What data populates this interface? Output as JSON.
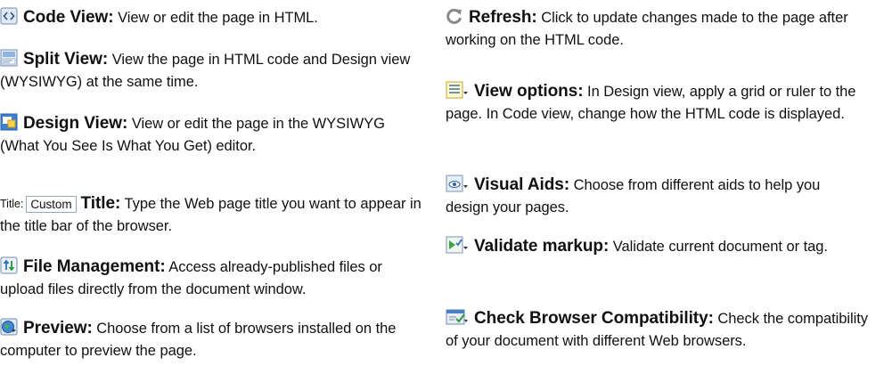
{
  "left": [
    {
      "icon": "code-view-icon",
      "term": "Code View:",
      "desc": " View or edit the page in HTML."
    },
    {
      "icon": "split-view-icon",
      "term": "Split View:",
      "desc": " View the page in HTML code and Design view (WYSIWYG) at the same time."
    },
    {
      "icon": "design-view-icon",
      "term": "Design View:",
      "desc": " View or edit the page in the WYSIWYG (What You See Is What You Get) editor."
    },
    {
      "title_widget_label": "Title:",
      "title_widget_value": "Custom",
      "term": "Title:",
      "desc": " Type the Web page title you want to appear in the title bar of the browser."
    },
    {
      "icon": "file-management-icon",
      "term": "File Management:",
      "desc": " Access already-published files or upload files directly from the document window."
    },
    {
      "icon": "preview-globe-icon",
      "term": "Preview:",
      "desc": " Choose from a list of browsers installed on the computer to preview the page."
    }
  ],
  "right": [
    {
      "icon": "refresh-icon",
      "term": "Refresh:",
      "desc": " Click to update changes made to the page after working on the HTML code."
    },
    {
      "icon": "view-options-icon",
      "term": "View options:",
      "desc": " In Design view, apply a grid or ruler to the page. In Code view, change how the HTML code is displayed."
    },
    {
      "icon": "visual-aids-icon",
      "term": "Visual Aids:",
      "desc": " Choose from different aids to help you design your pages."
    },
    {
      "icon": "validate-markup-icon",
      "term": "Validate markup:",
      "desc": " Validate current document or tag."
    },
    {
      "icon": "browser-compat-icon",
      "term": "Check Browser Compatibility:",
      "desc": " Check the compatibility of your document with different Web browsers."
    }
  ]
}
